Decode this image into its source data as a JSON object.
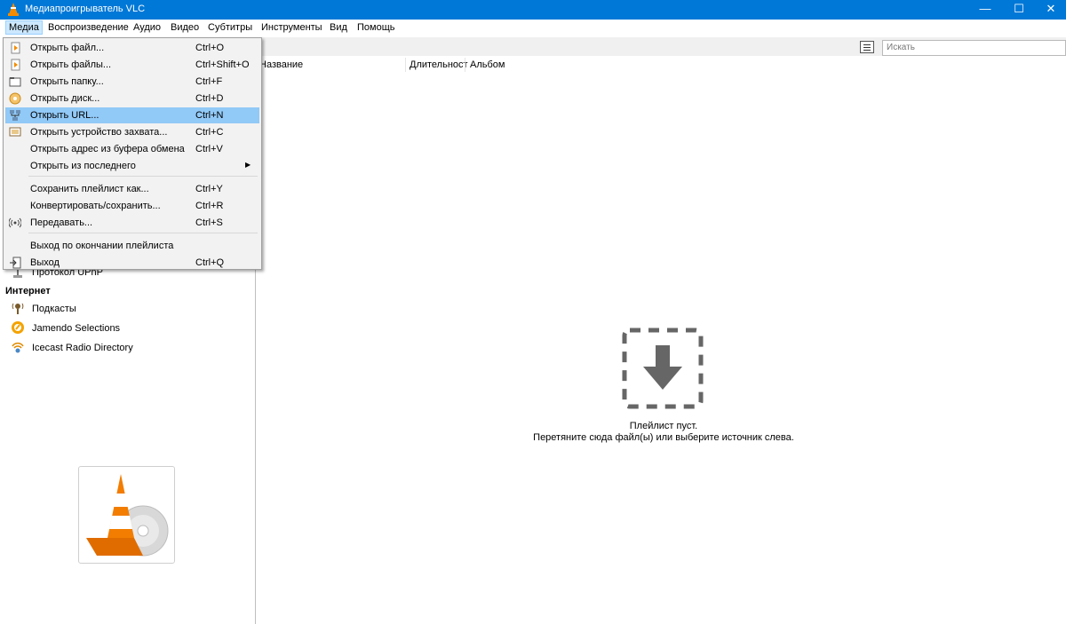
{
  "window": {
    "title": "Медиапроигрыватель VLC",
    "minimize": "—",
    "maximize": "☐",
    "close": "✕"
  },
  "menubar": [
    "Медиа",
    "Воспроизведение",
    "Аудио",
    "Видео",
    "Субтитры",
    "Инструменты",
    "Вид",
    "Помощь"
  ],
  "search": {
    "placeholder": "Искать"
  },
  "playlist": {
    "columns": [
      "Название",
      "Длительност",
      "Альбом"
    ],
    "empty_line1": "Плейлист пуст.",
    "empty_line2": "Перетяните сюда файл(ы) или выберите источник слева."
  },
  "sidebar": {
    "partial_item": "Протокол UPnP",
    "internet_title": "Интернет",
    "internet_items": [
      "Подкасты",
      "Jamendo Selections",
      "Icecast Radio Directory"
    ]
  },
  "media_menu": {
    "items": [
      {
        "label": "Открыть файл...",
        "shortcut": "Ctrl+O",
        "icon": "file-icon"
      },
      {
        "label": "Открыть файлы...",
        "shortcut": "Ctrl+Shift+O",
        "icon": "files-icon"
      },
      {
        "label": "Открыть папку...",
        "shortcut": "Ctrl+F",
        "icon": "folder-icon"
      },
      {
        "label": "Открыть диск...",
        "shortcut": "Ctrl+D",
        "icon": "disc-icon"
      },
      {
        "label": "Открыть URL...",
        "shortcut": "Ctrl+N",
        "icon": "network-icon",
        "highlighted": true
      },
      {
        "label": "Открыть устройство захвата...",
        "shortcut": "Ctrl+C",
        "icon": "capture-icon"
      },
      {
        "label": "Открыть адрес из буфера обмена",
        "shortcut": "Ctrl+V",
        "icon": ""
      },
      {
        "label": "Открыть из последнего",
        "shortcut": "",
        "icon": "",
        "submenu": true
      },
      {
        "label": "Сохранить плейлист как...",
        "shortcut": "Ctrl+Y",
        "icon": ""
      },
      {
        "label": "Конвертировать/сохранить...",
        "shortcut": "Ctrl+R",
        "icon": ""
      },
      {
        "label": "Передавать...",
        "shortcut": "Ctrl+S",
        "icon": "stream-icon"
      },
      {
        "label": "Выход по окончании плейлиста",
        "shortcut": "",
        "icon": ""
      },
      {
        "label": "Выход",
        "shortcut": "Ctrl+Q",
        "icon": "exit-icon"
      }
    ]
  }
}
